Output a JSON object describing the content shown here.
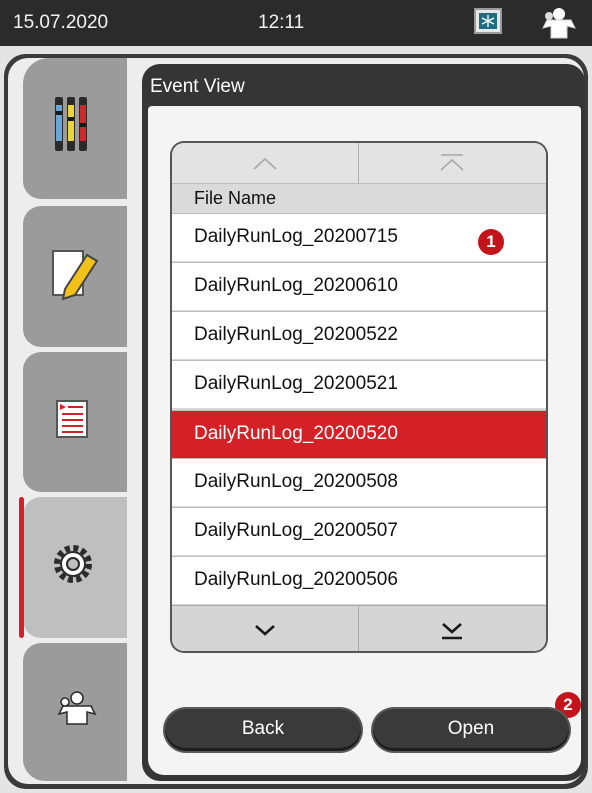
{
  "statusbar": {
    "date": "15.07.2020",
    "time": "12:11",
    "cooling_icon": "snowflake-cooling-icon",
    "user_icon": "user-icon"
  },
  "sidebar": {
    "items": [
      {
        "icon": "reagent-bottles-icon",
        "active": false
      },
      {
        "icon": "edit-document-icon",
        "active": false
      },
      {
        "icon": "program-list-icon",
        "active": false
      },
      {
        "icon": "gear-icon",
        "active": true
      },
      {
        "icon": "user-icon",
        "active": false
      }
    ],
    "active_indicator_color": "#d62027"
  },
  "panel": {
    "title": "Event View"
  },
  "file_list": {
    "column_header": "File Name",
    "rows": [
      "DailyRunLog_20200715",
      "DailyRunLog_20200610",
      "DailyRunLog_20200522",
      "DailyRunLog_20200521",
      "DailyRunLog_20200520",
      "DailyRunLog_20200508",
      "DailyRunLog_20200507",
      "DailyRunLog_20200506"
    ],
    "selected": "DailyRunLog_20200520",
    "selection_color": "#d42027"
  },
  "callouts": {
    "one": "1",
    "two": "2"
  },
  "buttons": {
    "back": "Back",
    "open": "Open"
  }
}
